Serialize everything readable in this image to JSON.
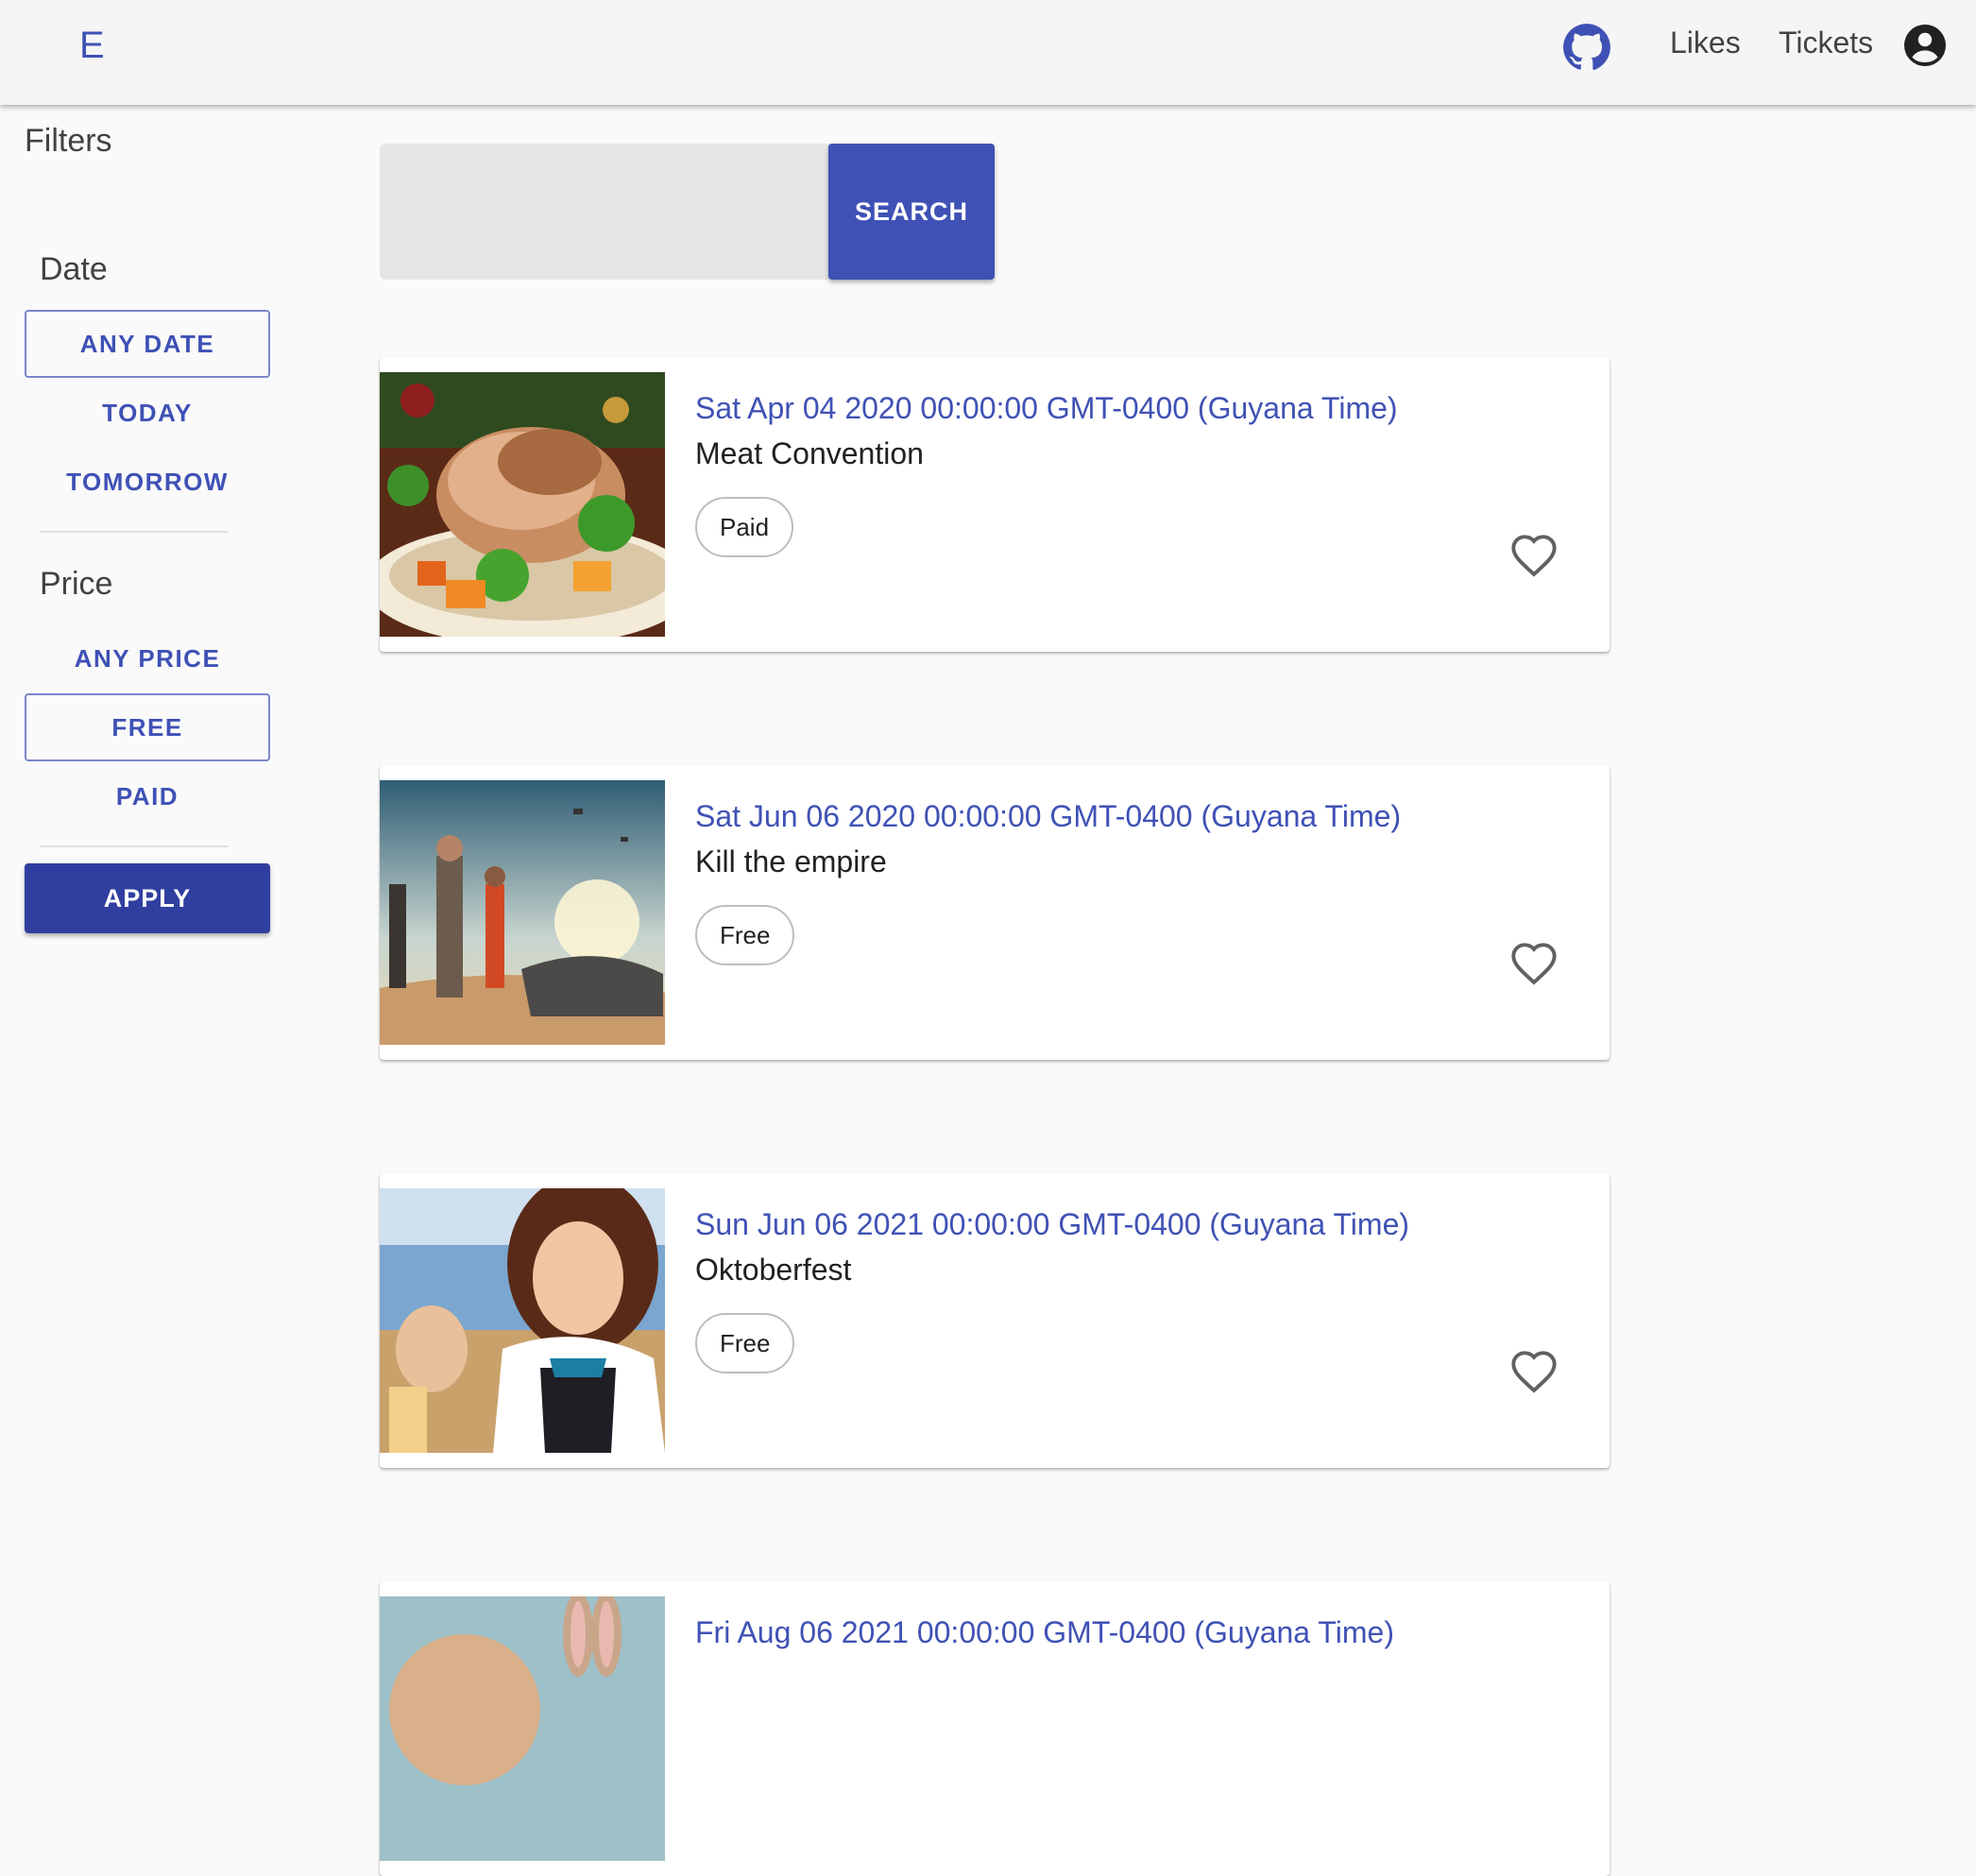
{
  "app": {
    "logo": "E"
  },
  "nav": {
    "github_icon": "github-icon",
    "likes": "Likes",
    "tickets": "Tickets",
    "account_icon": "account-circle-icon"
  },
  "filters": {
    "title": "Filters",
    "date": {
      "title": "Date",
      "options": [
        "ANY DATE",
        "TODAY",
        "TOMORROW"
      ],
      "selected": "ANY DATE"
    },
    "price": {
      "title": "Price",
      "options": [
        "ANY PRICE",
        "FREE",
        "PAID"
      ],
      "selected": "FREE"
    },
    "apply": "APPLY"
  },
  "search": {
    "value": "",
    "button": "SEARCH"
  },
  "events": [
    {
      "date": "Sat Apr 04 2020 00:00:00 GMT-0400 (Guyana Time)",
      "title": "Meat Convention",
      "price": "Paid",
      "image": "roast-meat-photo"
    },
    {
      "date": "Sat Jun 06 2020 00:00:00 GMT-0400 (Guyana Time)",
      "title": "Kill the empire",
      "price": "Free",
      "image": "star-wars-photo"
    },
    {
      "date": "Sun Jun 06 2021 00:00:00 GMT-0400 (Guyana Time)",
      "title": "Oktoberfest",
      "price": "Free",
      "image": "oktoberfest-photo"
    },
    {
      "date": "Fri Aug 06 2021 00:00:00 GMT-0400 (Guyana Time)",
      "image": "bunny-photo"
    }
  ],
  "colors": {
    "primary": "#3f51b5",
    "primary_dark": "#303f9f",
    "appbar_bg": "#f5f5f5",
    "page_bg": "#fafafa",
    "outline": "#7986cb"
  }
}
